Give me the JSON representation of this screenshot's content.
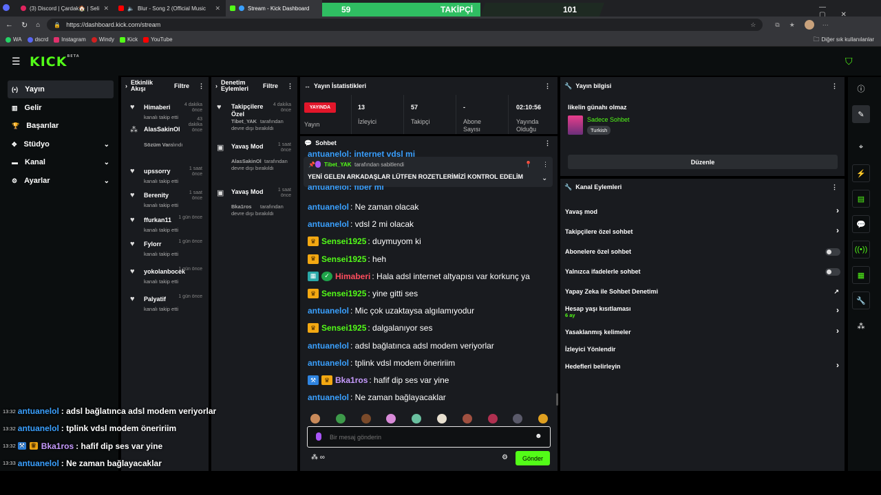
{
  "browser": {
    "tabs": [
      {
        "label": "(3) Discord | Çardak🏠 | Seli"
      },
      {
        "label": "Blur - Song 2 (Official Music"
      },
      {
        "label": "Stream - Kick Dashboard"
      }
    ],
    "follow_bar": {
      "left": "59",
      "center": "TAKİPÇİ",
      "right": "101"
    },
    "url": "https://dashboard.kick.com/stream",
    "bookmarks": [
      "WA",
      "dscrd",
      "Instagram",
      "Windy",
      "Kick",
      "YouTube"
    ],
    "bookmarks_right": "Diğer sık kullanılanlar"
  },
  "kick": {
    "logo": "KICK",
    "logo_sup": "BETA"
  },
  "sidebar": {
    "items": [
      {
        "label": "Yayın"
      },
      {
        "label": "Gelir"
      },
      {
        "label": "Başarılar"
      },
      {
        "label": "Stüdyo"
      },
      {
        "label": "Kanal"
      },
      {
        "label": "Ayarlar"
      }
    ]
  },
  "activity": {
    "title": "Etkinlik Akışı",
    "filter": "Filtre",
    "events": [
      {
        "name": "Himaberi",
        "time": "4 dakika önce",
        "desc": "kanalı takip etti"
      },
      {
        "name": "AlasSakinOl",
        "time": "43 dakika önce",
        "desc_green": "Sözüm Var",
        "desc": "alındı"
      },
      {
        "name": "upssorry",
        "time": "1 saat önce",
        "desc": "kanalı takip etti"
      },
      {
        "name": "Berenity",
        "time": "1 saat önce",
        "desc": "kanalı takip etti"
      },
      {
        "name": "ffurkan11",
        "time": "1 gün önce",
        "desc": "kanalı takip etti"
      },
      {
        "name": "Fylorr",
        "time": "1 gün önce",
        "desc": "kanalı takip etti"
      },
      {
        "name": "yokolanbocek",
        "time": "1 gün önce",
        "desc": "kanalı takip etti"
      },
      {
        "name": "Palyatif",
        "time": "1 gün önce",
        "desc": "kanalı takip etti"
      }
    ]
  },
  "moderation": {
    "title": "Denetim Eylemleri",
    "filter": "Filtre",
    "actions": [
      {
        "name": "Takipçilere Özel",
        "time": "4 dakika önce",
        "user": "Tibet_YAK",
        "desc": "tarafından devre dışı bırakıldı"
      },
      {
        "name": "Yavaş Mod",
        "time": "1 saat önce",
        "user": "AlasSakinOl",
        "desc": "tarafından devre dışı bırakıldı"
      },
      {
        "name": "Yavaş Mod",
        "time": "1 saat önce",
        "user": "Bka1ros",
        "desc": "tarafından devre dışı bırakıldı"
      }
    ]
  },
  "stats": {
    "title": "Yayın İstatistikleri",
    "live_badge": "YAYINDA",
    "live_label": "Yayın",
    "items": [
      {
        "value": "13",
        "label": "İzleyici"
      },
      {
        "value": "57",
        "label": "Takipçi"
      },
      {
        "value": "-",
        "label": "Abone Sayısı"
      },
      {
        "value": "02:10:56",
        "label": "Yayında Olduğu"
      }
    ]
  },
  "chat": {
    "title": "Sohbet",
    "pinned_by_user": "Tibet_YAK",
    "pinned_by_text": "tarafından sabitlendi",
    "pinned_message": "YENİ GELEN ARKADAŞLAR LÜTFEN ROZETLERİMİZİ KONTROL EDELİM",
    "partial_top": "antuanelol: internet vdsl mi",
    "partial_2": "antuanelol: fiber mi",
    "messages": [
      {
        "user": "antuanelol",
        "color": "blue",
        "text": ": Ne zaman olacak",
        "badges": []
      },
      {
        "user": "antuanelol",
        "color": "blue",
        "text": ": vdsl 2 mi olacak",
        "badges": []
      },
      {
        "user": "Sensei1925",
        "color": "green",
        "text": ": duymuyom ki",
        "badges": [
          "crown"
        ]
      },
      {
        "user": "Sensei1925",
        "color": "green",
        "text": ": heh",
        "badges": [
          "crown"
        ]
      },
      {
        "user": "Himaberi",
        "color": "red",
        "text": ": Hala adsl internet altyapısı var korkunç ya",
        "badges": [
          "og",
          "verified"
        ]
      },
      {
        "user": "Sensei1925",
        "color": "green",
        "text": ": yine gitti ses",
        "badges": [
          "crown"
        ]
      },
      {
        "user": "antuanelol",
        "color": "blue",
        "text": ": Mic çok uzaktaysa algılamıyodur",
        "badges": []
      },
      {
        "user": "Sensei1925",
        "color": "green",
        "text": ": dalgalanıyor ses",
        "badges": [
          "crown"
        ]
      },
      {
        "user": "antuanelol",
        "color": "blue",
        "text": ": adsl bağlatınca adsl modem veriyorlar",
        "badges": []
      },
      {
        "user": "antuanelol",
        "color": "blue",
        "text": ": tplink vdsl modem öneririim",
        "badges": []
      },
      {
        "user": "Bka1ros",
        "color": "purp",
        "text": ": hafif dip ses var yine",
        "badges": [
          "mod",
          "crown"
        ]
      },
      {
        "user": "antuanelol",
        "color": "blue",
        "text": ": Ne zaman bağlayacaklar",
        "badges": []
      }
    ],
    "input_placeholder": "Bir mesaj gönderin",
    "send_label": "Gönder"
  },
  "overlay": [
    {
      "time": "13:32",
      "user": "antuanelol",
      "color": "blue",
      "text": ": adsl bağlatınca adsl modem veriyorlar",
      "badges": []
    },
    {
      "time": "13:32",
      "user": "antuanelol",
      "color": "blue",
      "text": ": tplink vdsl modem öneririim",
      "badges": []
    },
    {
      "time": "13:32",
      "user": "Bka1ros",
      "color": "purp",
      "text": ": hafif dip ses var yine",
      "badges": [
        "mod",
        "crown"
      ]
    },
    {
      "time": "13:33",
      "user": "antuanelol",
      "color": "blue",
      "text": ": Ne zaman bağlayacaklar",
      "badges": []
    }
  ],
  "stream_info": {
    "title": "Yayın bilgisi",
    "stream_title": "likelin günahı olmaz",
    "category": "Sadece Sohbet",
    "language": "Turkish",
    "edit_label": "Düzenle"
  },
  "channel_actions": {
    "title": "Kanal Eylemleri",
    "items": [
      {
        "label": "Yavaş mod",
        "control": "arrow"
      },
      {
        "label": "Takipçilere özel sohbet",
        "control": "arrow"
      },
      {
        "label": "Abonelere özel sohbet",
        "control": "toggle"
      },
      {
        "label": "Yalnızca ifadelerle sohbet",
        "control": "toggle"
      },
      {
        "label": "Yapay Zeka ile Sohbet Denetimi",
        "control": "external"
      },
      {
        "label": "Hesap yaşı kısıtlaması",
        "sub": "6 ay",
        "control": "arrow"
      },
      {
        "label": "Yasaklanmış kelimeler",
        "control": "arrow"
      },
      {
        "label": "İzleyici Yönlendir",
        "control": "none"
      },
      {
        "label": "Hedefleri belirleyin",
        "control": "arrow"
      }
    ]
  },
  "colors": {
    "accent": "#53fc18",
    "panel": "#191b1f",
    "bg": "#0b0e0f"
  }
}
